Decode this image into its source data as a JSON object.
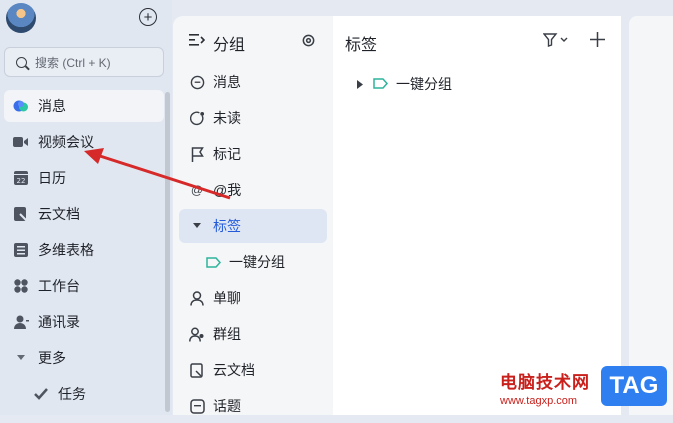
{
  "sidebar": {
    "new_icon": "plus-circle-icon",
    "search": {
      "placeholder": "搜索 (Ctrl + K)"
    },
    "items": [
      {
        "label": "消息",
        "icon": "message-icon",
        "active": true
      },
      {
        "label": "视频会议",
        "icon": "video-icon",
        "active": false
      },
      {
        "label": "日历",
        "icon": "calendar-icon",
        "icon_text": "22",
        "active": false
      },
      {
        "label": "云文档",
        "icon": "doc-icon",
        "active": false
      },
      {
        "label": "多维表格",
        "icon": "table-icon",
        "active": false
      },
      {
        "label": "工作台",
        "icon": "grid-icon",
        "active": false
      },
      {
        "label": "通讯录",
        "icon": "contacts-icon",
        "active": false
      },
      {
        "label": "更多",
        "icon": "caret-down-icon",
        "active": false
      },
      {
        "label": "任务",
        "icon": "check-icon",
        "active": false
      }
    ]
  },
  "groups": {
    "title": "分组",
    "items": [
      {
        "label": "消息",
        "icon": "chat-icon"
      },
      {
        "label": "未读",
        "icon": "unread-icon"
      },
      {
        "label": "标记",
        "icon": "flag-icon"
      },
      {
        "label": "@我",
        "icon": "at-icon"
      },
      {
        "label": "标签",
        "icon": "caret-down-icon",
        "active": true
      },
      {
        "label": "一键分组",
        "icon": "tag-icon",
        "sub": true
      },
      {
        "label": "单聊",
        "icon": "person-icon"
      },
      {
        "label": "群组",
        "icon": "group-icon"
      },
      {
        "label": "云文档",
        "icon": "doc-icon"
      },
      {
        "label": "话题",
        "icon": "topic-icon"
      }
    ]
  },
  "tags": {
    "title": "标签",
    "rows": [
      {
        "label": "一键分组",
        "icon": "tag-icon"
      }
    ]
  },
  "watermark": {
    "site": "电脑技术网",
    "url": "www.tagxp.com",
    "badge": "TAG"
  },
  "colors": {
    "accent": "#245bdb",
    "tag": "#2fb39c",
    "arrow": "#d62a2a"
  }
}
